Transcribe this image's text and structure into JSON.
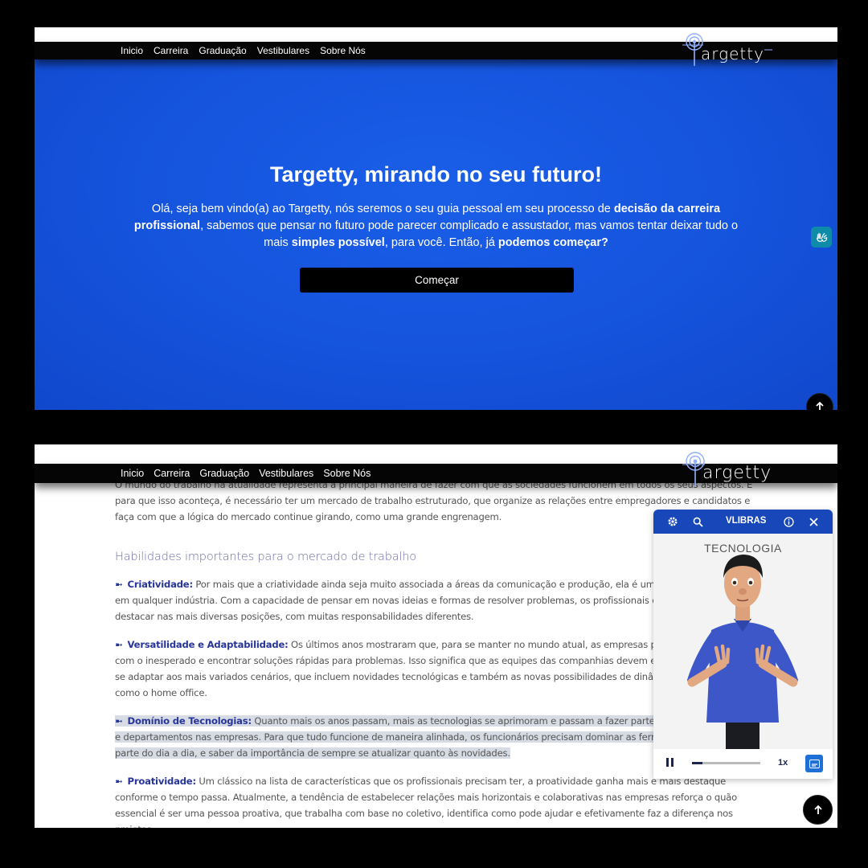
{
  "colors": {
    "brand_blue": "#1553dc",
    "nav_bg": "#050505",
    "vlibras_blue": "#1747b8",
    "skill_title": "#27349a"
  },
  "nav": {
    "items": [
      "Inicio",
      "Carreira",
      "Graduação",
      "Vestibulares",
      "Sobre Nós"
    ],
    "logo_text": "argetty"
  },
  "hero": {
    "title": "Targetty, mirando no seu futuro!",
    "para": [
      {
        "t": "Olá, seja bem vindo(a) ao Targetty, nós seremos o seu guia pessoal em seu processo de ",
        "b": false
      },
      {
        "t": "decisão da carreira profissional",
        "b": true
      },
      {
        "t": ", sabemos que pensar no futuro pode parecer complicado e assustador, mas vamos tentar deixar tudo o mais ",
        "b": false
      },
      {
        "t": "simples possível",
        "b": true
      },
      {
        "t": ", para você. Então, já ",
        "b": false
      },
      {
        "t": "podemos começar?",
        "b": true
      }
    ],
    "button_label": "Começar"
  },
  "icons": {
    "libras": "hands-sign-icon",
    "back_to_top": "arrow-up-icon"
  },
  "article": {
    "intro": "O mundo do trabalho na atualidade representa a principal maneira de fazer com que as sociedades funcionem em todos os seus aspectos. E para que isso aconteça, é necessário ter um mercado de trabalho estruturado, que organize as relações entre empregadores e candidatos e faça com que a lógica do mercado continue girando, como uma grande engrenagem.",
    "heading": "Habilidades importantes para o mercado de trabalho",
    "arrow": "➼",
    "skills": [
      {
        "title": "Criatividade:",
        "text": " Por mais que a criatividade ainda seja muito associada a áreas da comunicação e produção, ela é uma habilidade essencial em qualquer indústria. Com a capacidade de pensar em novas ideias e formas de resolver problemas, os profissionais conseguem se destacar nas mais diversas posições, com muitas responsabilidades diferentes."
      },
      {
        "title": "Versatilidade e Adaptabilidade:",
        "text": " Os últimos anos mostraram que, para se manter no mundo atual, as empresas precisam saber lidar com o inesperado e encontrar soluções rápidas para problemas. Isso significa que as equipes das companhias devem estar preparadas para se adaptar aos mais variados cenários, que incluem novidades tecnológicas e também as novas possibilidades de dinâmicas de trabalho, como o home office."
      },
      {
        "title": "Domínio de Tecnologias:",
        "text": " Quanto mais os anos passam, mais as tecnologias se aprimoram e passam a fazer parte de diversos processos e departamentos nas empresas. Para que tudo funcione de maneira alinhada, os funcionários precisam dominar as ferramentas que já fazem parte do dia a dia, e saber da importância de sempre se atualizar quanto às novidades."
      },
      {
        "title": "Proatividade:",
        "text": " Um clássico na lista de características que os profissionais precisam ter, a proatividade ganha mais e mais destaque conforme o tempo passa. Atualmente, a tendência de estabelecer relações mais horizontais e colaborativas nas empresas reforça o quão essencial é ser uma pessoa proativa, que trabalha com base no coletivo, identifica como pode ajudar e efetivamente faz a diferença nos projetos."
      }
    ]
  },
  "vlibras": {
    "title": "VLIBRAS",
    "word": "TECNOLOGIA",
    "speed": "1x",
    "progress": 0.15
  }
}
